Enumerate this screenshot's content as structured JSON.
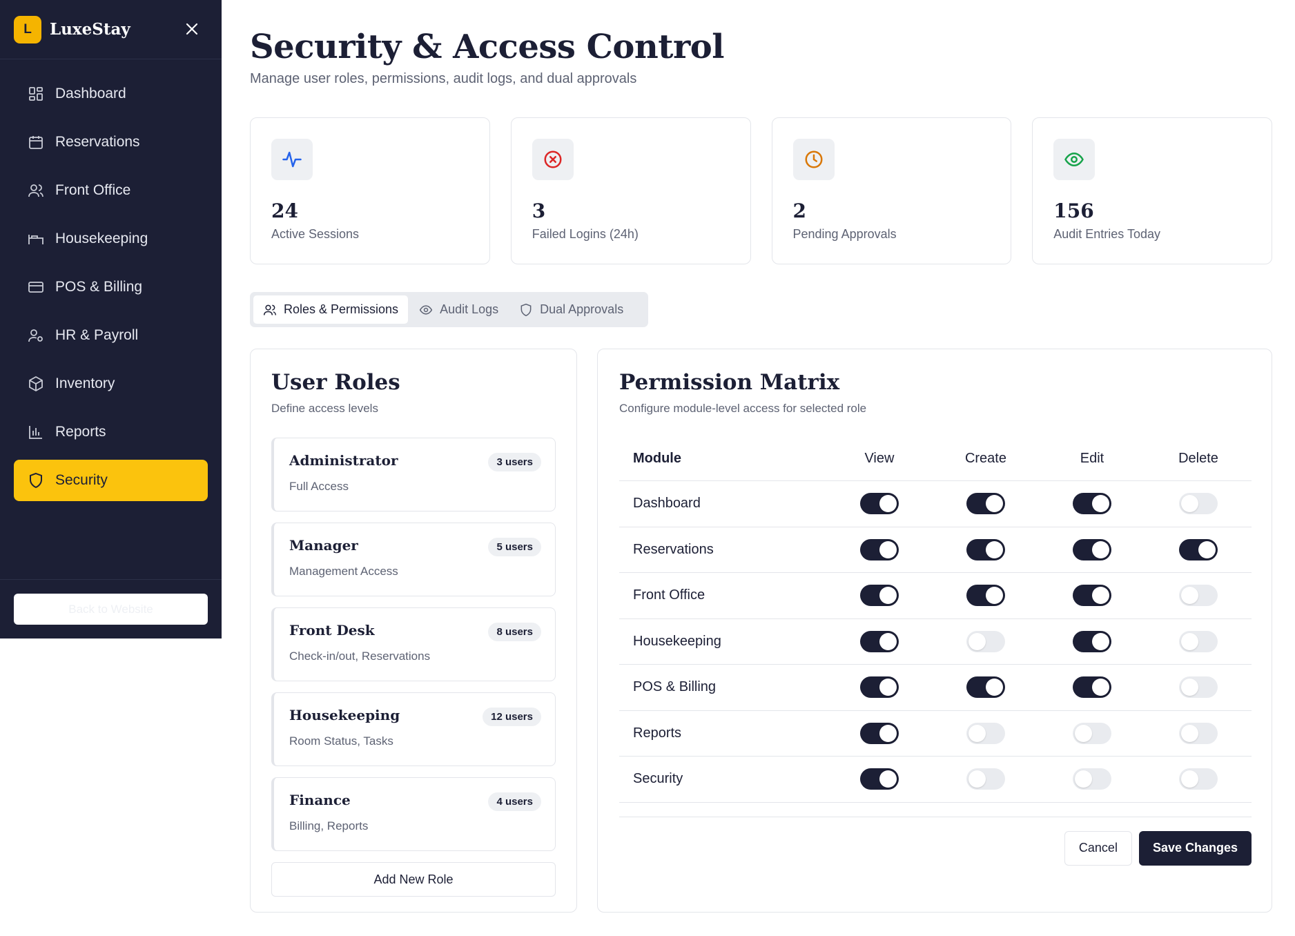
{
  "app": {
    "logo_letter": "L",
    "name": "LuxeStay"
  },
  "sidebar": {
    "items": [
      {
        "label": "Dashboard",
        "icon": "dashboard-icon"
      },
      {
        "label": "Reservations",
        "icon": "calendar-icon"
      },
      {
        "label": "Front Office",
        "icon": "users-icon"
      },
      {
        "label": "Housekeeping",
        "icon": "bed-icon"
      },
      {
        "label": "POS & Billing",
        "icon": "credit-card-icon"
      },
      {
        "label": "HR & Payroll",
        "icon": "user-cog-icon"
      },
      {
        "label": "Inventory",
        "icon": "package-icon"
      },
      {
        "label": "Reports",
        "icon": "bar-chart-icon"
      },
      {
        "label": "Security",
        "icon": "shield-icon",
        "active": true
      }
    ],
    "back_label": "Back to Website"
  },
  "header": {
    "title": "Security & Access Control",
    "subtitle": "Manage user roles, permissions, audit logs, and dual approvals"
  },
  "stats": [
    {
      "value": "24",
      "label": "Active Sessions",
      "icon": "activity-icon",
      "color": "#2563eb"
    },
    {
      "value": "3",
      "label": "Failed Logins (24h)",
      "icon": "x-circle-icon",
      "color": "#dc2626"
    },
    {
      "value": "2",
      "label": "Pending Approvals",
      "icon": "clock-icon",
      "color": "#d97706"
    },
    {
      "value": "156",
      "label": "Audit Entries Today",
      "icon": "eye-icon",
      "color": "#16a34a"
    }
  ],
  "tabs": [
    {
      "label": "Roles & Permissions",
      "active": true
    },
    {
      "label": "Audit Logs"
    },
    {
      "label": "Dual Approvals"
    }
  ],
  "roles_panel": {
    "title": "User Roles",
    "subtitle": "Define access levels",
    "roles": [
      {
        "name": "Administrator",
        "desc": "Full Access",
        "count": "3 users"
      },
      {
        "name": "Manager",
        "desc": "Management Access",
        "count": "5 users"
      },
      {
        "name": "Front Desk",
        "desc": "Check-in/out, Reservations",
        "count": "8 users"
      },
      {
        "name": "Housekeeping",
        "desc": "Room Status, Tasks",
        "count": "12 users"
      },
      {
        "name": "Finance",
        "desc": "Billing, Reports",
        "count": "4 users"
      }
    ],
    "add_label": "Add New Role"
  },
  "matrix_panel": {
    "title": "Permission Matrix",
    "subtitle": "Configure module-level access for selected role",
    "columns": [
      "Module",
      "View",
      "Create",
      "Edit",
      "Delete"
    ],
    "rows": [
      {
        "module": "Dashboard",
        "perms": [
          true,
          true,
          true,
          false
        ]
      },
      {
        "module": "Reservations",
        "perms": [
          true,
          true,
          true,
          true
        ]
      },
      {
        "module": "Front Office",
        "perms": [
          true,
          true,
          true,
          false
        ]
      },
      {
        "module": "Housekeeping",
        "perms": [
          true,
          false,
          true,
          false
        ]
      },
      {
        "module": "POS & Billing",
        "perms": [
          true,
          true,
          true,
          false
        ]
      },
      {
        "module": "Reports",
        "perms": [
          true,
          false,
          false,
          false
        ]
      },
      {
        "module": "Security",
        "perms": [
          true,
          false,
          false,
          false
        ]
      }
    ],
    "cancel_label": "Cancel",
    "save_label": "Save Changes"
  },
  "colors": {
    "sidebar_bg": "#1c1f35",
    "accent": "#fbc30d",
    "toggle_on": "#1c1f35"
  }
}
